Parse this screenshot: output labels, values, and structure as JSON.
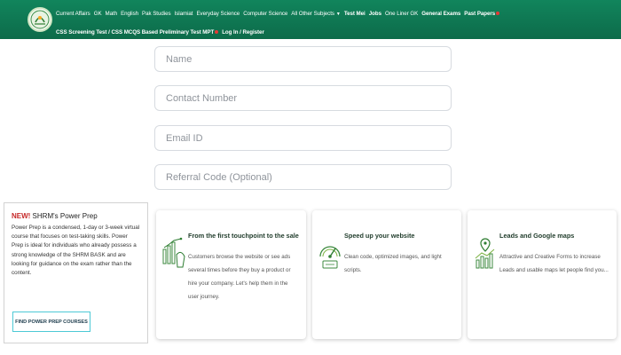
{
  "header": {
    "logo_icon": "site-logo-icon",
    "nav_row1": [
      {
        "label": "Current Affairs",
        "bold": false
      },
      {
        "label": "GK",
        "bold": false
      },
      {
        "label": "Math",
        "bold": false
      },
      {
        "label": "English",
        "bold": false
      },
      {
        "label": "Pak Studies",
        "bold": false
      },
      {
        "label": "Islamiat",
        "bold": false
      },
      {
        "label": "Everyday Science",
        "bold": false
      },
      {
        "label": "Computer Science",
        "bold": false
      },
      {
        "label": "All Other Subjects",
        "bold": false,
        "dropdown": true
      },
      {
        "label": "Test Mei",
        "bold": true
      },
      {
        "label": "Jobs",
        "bold": true
      },
      {
        "label": "One Liner GK",
        "bold": false
      },
      {
        "label": "General Exams",
        "bold": true
      },
      {
        "label": "Past Papers",
        "bold": true,
        "badge": true
      }
    ],
    "nav_row2": [
      {
        "label": "CSS Screening Test / CSS MCQS Based Preliminary Test MPT",
        "bold": true,
        "badge": true
      },
      {
        "label": "Log In / Register",
        "bold": true
      }
    ],
    "colors": {
      "bg": "#0f7a54",
      "badge": "#e53935"
    }
  },
  "form": {
    "name_placeholder": "Name",
    "contact_placeholder": "Contact Number",
    "email_placeholder": "Email ID",
    "referral_placeholder": "Referral Code (Optional)"
  },
  "ad": {
    "new_label": "NEW!",
    "title": " SHRM's Power Prep",
    "body": "Power Prep is a condensed, 1-day or 3-week virtual course that focuses on test-taking skills. Power Prep is ideal for individuals who already possess a strong knowledge of the SHRM BASK and are looking for guidance on the exam rather than the content.",
    "button_label": "FIND POWER PREP COURSES"
  },
  "cards": [
    {
      "icon": "touchpoint-chart-icon",
      "title": "From the first touchpoint to the sale",
      "text": "Customers browse the website or see ads several times before they buy a product or hire your company. Let's help them in the user journey."
    },
    {
      "icon": "speedometer-icon",
      "title": "Speed up your website",
      "text": "Clean code, optimized images, and light scripts."
    },
    {
      "icon": "leads-map-icon",
      "title": "Leads and Google maps",
      "text": "Attractive and Creative Forms to increase Leads and usable maps let people find you..."
    }
  ]
}
